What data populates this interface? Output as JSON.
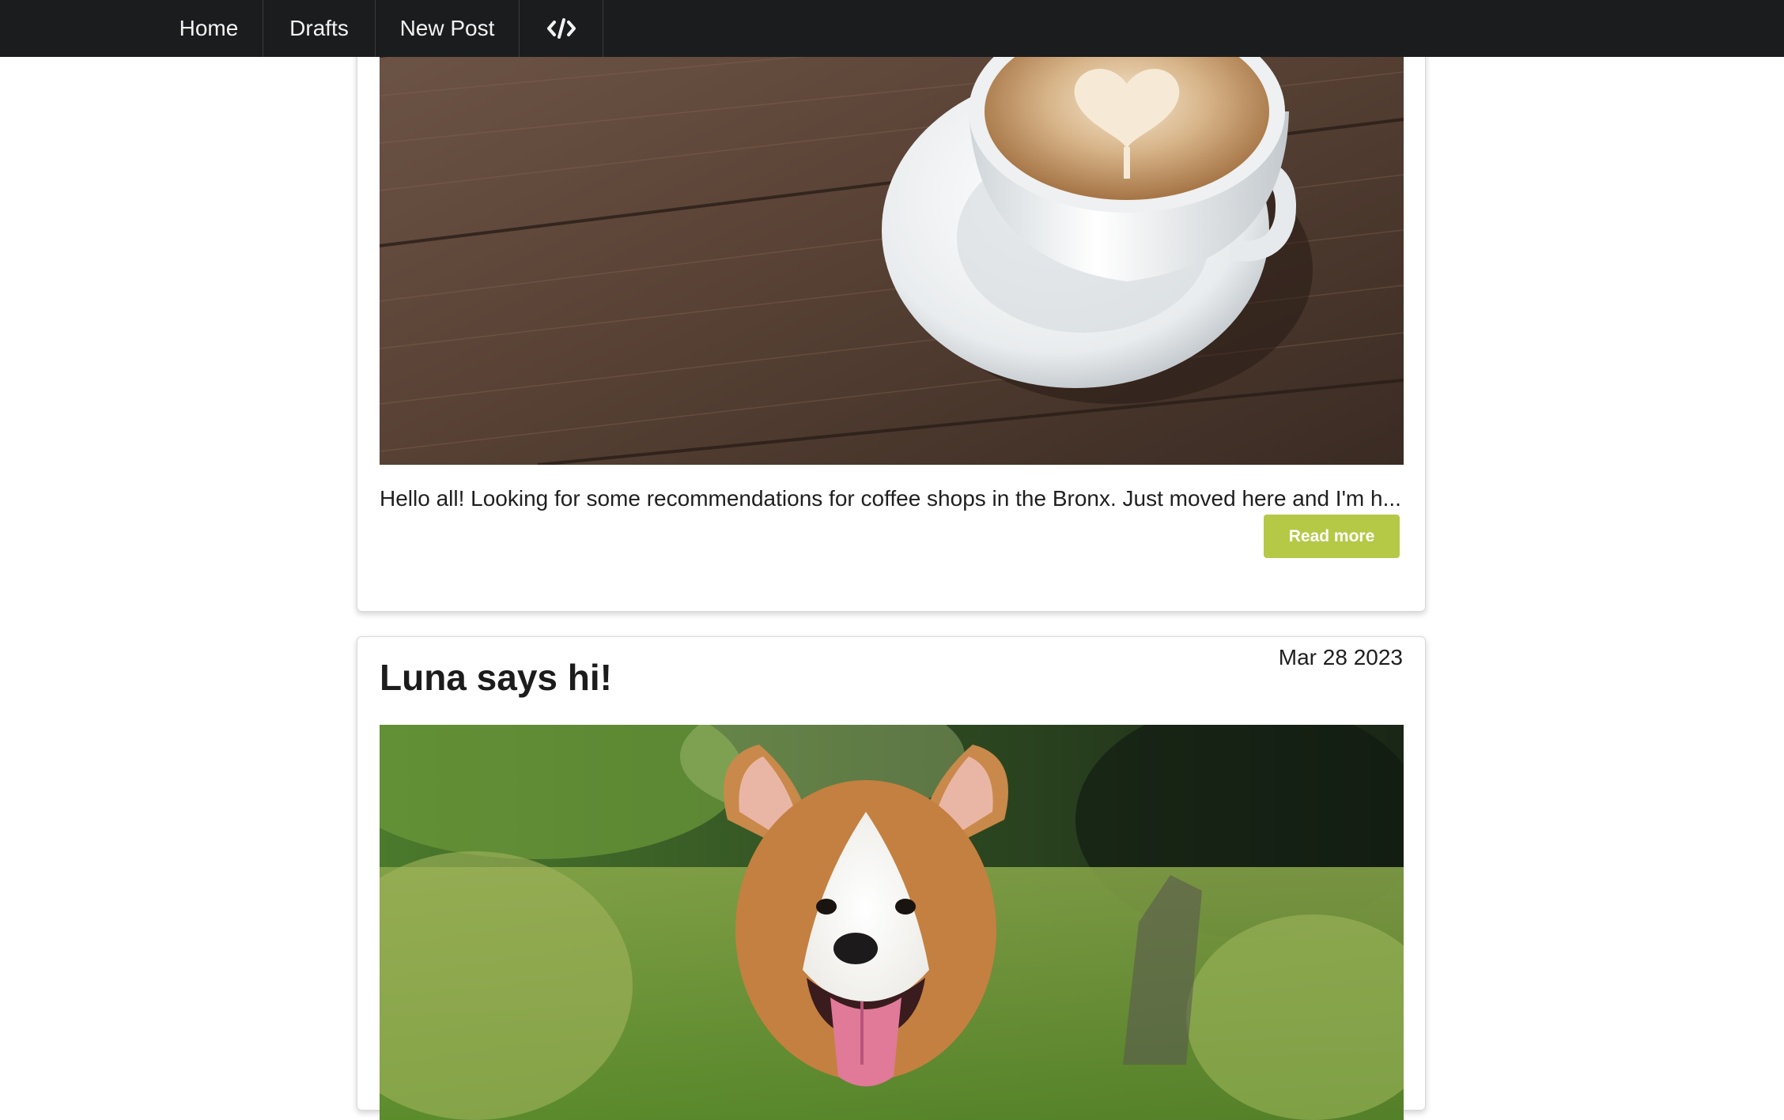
{
  "nav": {
    "items": [
      {
        "label": "Home"
      },
      {
        "label": "Drafts"
      },
      {
        "label": "New Post"
      }
    ],
    "code_icon": "code-brackets-icon"
  },
  "posts": [
    {
      "image": "coffee-latte-art-photo",
      "excerpt": "Hello all! Looking for some recommendations for coffee shops in the Bronx. Just moved here and I'm h...",
      "read_more_label": "Read more"
    },
    {
      "title": "Luna says hi!",
      "date": "Mar 28 2023",
      "image": "corgi-dog-photo"
    }
  ],
  "colors": {
    "topbar": "#1b1c1e",
    "accent": "#b5c947"
  }
}
